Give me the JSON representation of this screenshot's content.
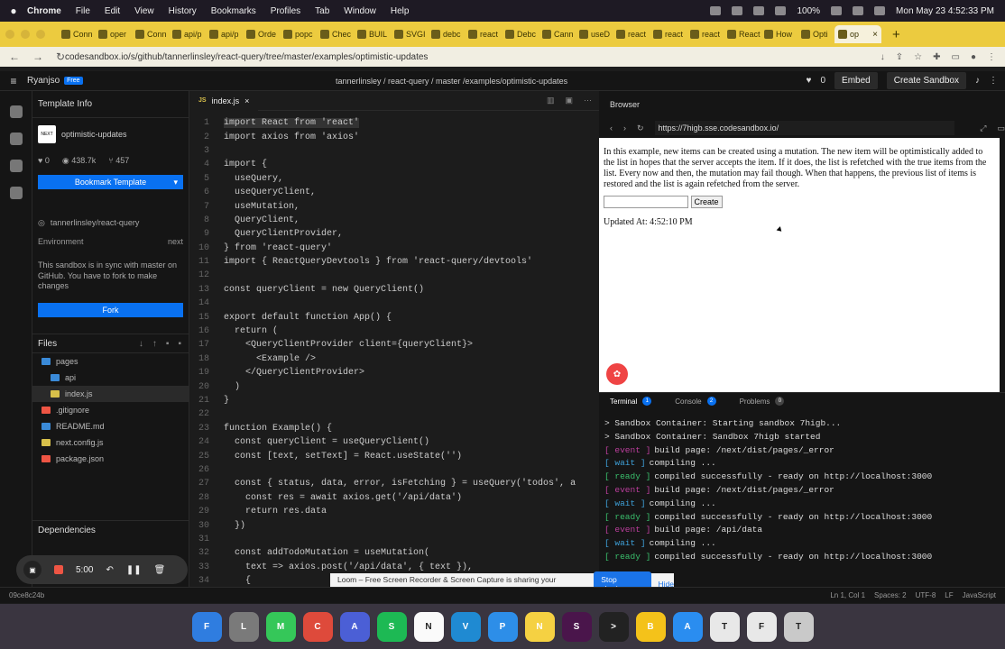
{
  "menubar": {
    "app": "Chrome",
    "items": [
      "File",
      "Edit",
      "View",
      "History",
      "Bookmarks",
      "Profiles",
      "Tab",
      "Window",
      "Help"
    ],
    "battery": "100%",
    "clock": "Mon May 23  4:52:33 PM"
  },
  "tabs": [
    {
      "label": "Conn"
    },
    {
      "label": "oper"
    },
    {
      "label": "Conn"
    },
    {
      "label": "api/p"
    },
    {
      "label": "api/p"
    },
    {
      "label": "Orde"
    },
    {
      "label": "popc"
    },
    {
      "label": "Chec"
    },
    {
      "label": "BUIL"
    },
    {
      "label": "SVGI"
    },
    {
      "label": "debc"
    },
    {
      "label": "react"
    },
    {
      "label": "Debc"
    },
    {
      "label": "Cann"
    },
    {
      "label": "useD"
    },
    {
      "label": "react"
    },
    {
      "label": "react"
    },
    {
      "label": "react"
    },
    {
      "label": "React"
    },
    {
      "label": "How"
    },
    {
      "label": "Opti"
    },
    {
      "label": "op"
    }
  ],
  "address": {
    "url": "codesandbox.io/s/github/tannerlinsley/react-query/tree/master/examples/optimistic-updates"
  },
  "csb": {
    "user": "Ryanjso",
    "plan": "Free",
    "repo": "tannerlinsley / react-query / master /examples/optimistic-updates",
    "likes": "0",
    "embed": "Embed",
    "create": "Create Sandbox"
  },
  "sidebar": {
    "section": "Template Info",
    "project": "optimistic-updates",
    "logo": "NEXT",
    "likes": "0",
    "views": "438.7k",
    "forks": "457",
    "bookmark": "Bookmark Template",
    "repo": "tannerlinsley/react-query",
    "env_label": "Environment",
    "env_value": "next",
    "sync": "This sandbox is in sync with master on GitHub. You have to fork to make changes",
    "fork": "Fork",
    "files_title": "Files",
    "files": [
      {
        "name": "pages",
        "color": "#3a8ad8"
      },
      {
        "name": "api",
        "color": "#3a8ad8"
      },
      {
        "name": "index.js",
        "color": "#d8c04a"
      },
      {
        "name": ".gitignore",
        "color": "#e54"
      },
      {
        "name": "README.md",
        "color": "#3a8ad8"
      },
      {
        "name": "next.config.js",
        "color": "#d8c04a"
      },
      {
        "name": "package.json",
        "color": "#e54"
      }
    ],
    "deps": "Dependencies"
  },
  "editor": {
    "file": "index.js",
    "lines": [
      "import React from 'react'",
      "import axios from 'axios'",
      "",
      "import {",
      "  useQuery,",
      "  useQueryClient,",
      "  useMutation,",
      "  QueryClient,",
      "  QueryClientProvider,",
      "} from 'react-query'",
      "import { ReactQueryDevtools } from 'react-query/devtools'",
      "",
      "const queryClient = new QueryClient()",
      "",
      "export default function App() {",
      "  return (",
      "    <QueryClientProvider client={queryClient}>",
      "      <Example />",
      "    </QueryClientProvider>",
      "  )",
      "}",
      "",
      "function Example() {",
      "  const queryClient = useQueryClient()",
      "  const [text, setText] = React.useState('')",
      "",
      "  const { status, data, error, isFetching } = useQuery('todos', a",
      "    const res = await axios.get('/api/data')",
      "    return res.data",
      "  })",
      "",
      "  const addTodoMutation = useMutation(",
      "    text => axios.post('/api/data', { text }),",
      "    {"
    ]
  },
  "browser": {
    "title": "Browser",
    "url": "https://7higb.sse.codesandbox.io/",
    "text": "In this example, new items can be created using a mutation. The new item will be optimistically added to the list in hopes that the server accepts the item. If it does, the list is refetched with the true items from the list. Every now and then, the mutation may fail though. When that happens, the previous list of items is restored and the list is again refetched from the server.",
    "button": "Create",
    "updated": "Updated At: 4:52:10 PM"
  },
  "terminal": {
    "tabs": [
      {
        "label": "Terminal",
        "count": "1"
      },
      {
        "label": "Console",
        "count": "2"
      },
      {
        "label": "Problems",
        "count": "0"
      }
    ],
    "lines": [
      {
        "tag": "",
        "text": "> Sandbox Container: Starting sandbox 7higb..."
      },
      {
        "tag": "",
        "text": "> Sandbox Container: Sandbox 7higb started"
      },
      {
        "tag": "event",
        "text": "build page: /next/dist/pages/_error"
      },
      {
        "tag": "wait",
        "text": "compiling ..."
      },
      {
        "tag": "ready",
        "text": "compiled successfully - ready on http://localhost:3000"
      },
      {
        "tag": "event",
        "text": "build page: /next/dist/pages/_error"
      },
      {
        "tag": "wait",
        "text": "compiling ..."
      },
      {
        "tag": "ready",
        "text": "compiled successfully - ready on http://localhost:3000"
      },
      {
        "tag": "event",
        "text": "build page: /api/data"
      },
      {
        "tag": "wait",
        "text": "compiling ..."
      },
      {
        "tag": "ready",
        "text": "compiled successfully - ready on http://localhost:3000"
      }
    ]
  },
  "recorder": {
    "time": "5:00"
  },
  "loom": {
    "message": "Loom – Free Screen Recorder & Screen Capture is sharing your screen.",
    "stop": "Stop sharing",
    "hide": "Hide"
  },
  "status": {
    "hash": "09ce8c24b",
    "pos": "Ln 1, Col 1",
    "spaces": "Spaces: 2",
    "enc": "UTF-8",
    "eol": "LF",
    "lang": "JavaScript"
  },
  "dock": [
    {
      "name": "finder",
      "color": "#2f7de0",
      "label": "F"
    },
    {
      "name": "launchpad",
      "color": "#7a7a7a",
      "label": "L"
    },
    {
      "name": "messages",
      "color": "#35c759",
      "label": "M"
    },
    {
      "name": "chrome",
      "color": "#de4a3b",
      "label": "C"
    },
    {
      "name": "app",
      "color": "#4b5fd6",
      "label": "A"
    },
    {
      "name": "spotify",
      "color": "#1db954",
      "label": "S"
    },
    {
      "name": "notion",
      "color": "#fafafa",
      "label": "N"
    },
    {
      "name": "vscode",
      "color": "#1f8ad2",
      "label": "V"
    },
    {
      "name": "app2",
      "color": "#2d8ee8",
      "label": "P"
    },
    {
      "name": "notes",
      "color": "#f5d142",
      "label": "N"
    },
    {
      "name": "slack",
      "color": "#4a154b",
      "label": "S"
    },
    {
      "name": "terminal",
      "color": "#222",
      "label": ">"
    },
    {
      "name": "bitwarden",
      "color": "#f4c21a",
      "label": "B"
    },
    {
      "name": "appstore",
      "color": "#2a8df0",
      "label": "A"
    },
    {
      "name": "textedit",
      "color": "#e8e8e8",
      "label": "T"
    },
    {
      "name": "files",
      "color": "#e8e8e8",
      "label": "F"
    },
    {
      "name": "trash",
      "color": "#c9c9c9",
      "label": "T"
    }
  ]
}
